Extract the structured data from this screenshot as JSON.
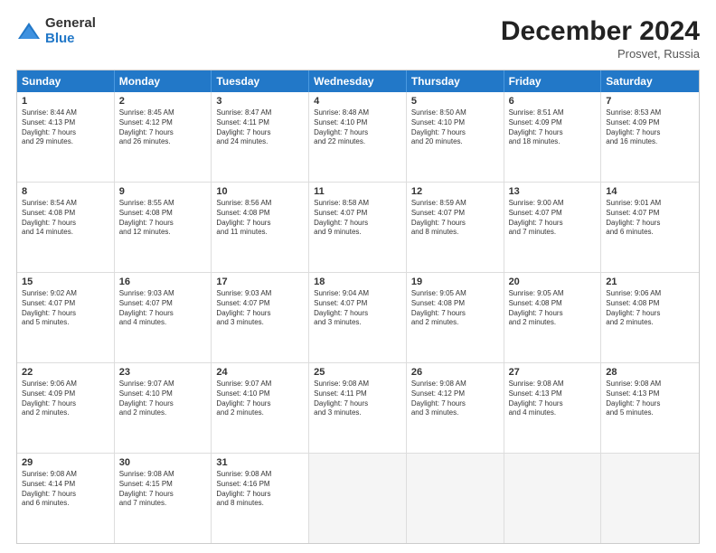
{
  "header": {
    "logo_general": "General",
    "logo_blue": "Blue",
    "title": "December 2024",
    "subtitle": "Prosvet, Russia"
  },
  "days_of_week": [
    "Sunday",
    "Monday",
    "Tuesday",
    "Wednesday",
    "Thursday",
    "Friday",
    "Saturday"
  ],
  "rows": [
    [
      {
        "day": "1",
        "info": "Sunrise: 8:44 AM\nSunset: 4:13 PM\nDaylight: 7 hours\nand 29 minutes."
      },
      {
        "day": "2",
        "info": "Sunrise: 8:45 AM\nSunset: 4:12 PM\nDaylight: 7 hours\nand 26 minutes."
      },
      {
        "day": "3",
        "info": "Sunrise: 8:47 AM\nSunset: 4:11 PM\nDaylight: 7 hours\nand 24 minutes."
      },
      {
        "day": "4",
        "info": "Sunrise: 8:48 AM\nSunset: 4:10 PM\nDaylight: 7 hours\nand 22 minutes."
      },
      {
        "day": "5",
        "info": "Sunrise: 8:50 AM\nSunset: 4:10 PM\nDaylight: 7 hours\nand 20 minutes."
      },
      {
        "day": "6",
        "info": "Sunrise: 8:51 AM\nSunset: 4:09 PM\nDaylight: 7 hours\nand 18 minutes."
      },
      {
        "day": "7",
        "info": "Sunrise: 8:53 AM\nSunset: 4:09 PM\nDaylight: 7 hours\nand 16 minutes."
      }
    ],
    [
      {
        "day": "8",
        "info": "Sunrise: 8:54 AM\nSunset: 4:08 PM\nDaylight: 7 hours\nand 14 minutes."
      },
      {
        "day": "9",
        "info": "Sunrise: 8:55 AM\nSunset: 4:08 PM\nDaylight: 7 hours\nand 12 minutes."
      },
      {
        "day": "10",
        "info": "Sunrise: 8:56 AM\nSunset: 4:08 PM\nDaylight: 7 hours\nand 11 minutes."
      },
      {
        "day": "11",
        "info": "Sunrise: 8:58 AM\nSunset: 4:07 PM\nDaylight: 7 hours\nand 9 minutes."
      },
      {
        "day": "12",
        "info": "Sunrise: 8:59 AM\nSunset: 4:07 PM\nDaylight: 7 hours\nand 8 minutes."
      },
      {
        "day": "13",
        "info": "Sunrise: 9:00 AM\nSunset: 4:07 PM\nDaylight: 7 hours\nand 7 minutes."
      },
      {
        "day": "14",
        "info": "Sunrise: 9:01 AM\nSunset: 4:07 PM\nDaylight: 7 hours\nand 6 minutes."
      }
    ],
    [
      {
        "day": "15",
        "info": "Sunrise: 9:02 AM\nSunset: 4:07 PM\nDaylight: 7 hours\nand 5 minutes."
      },
      {
        "day": "16",
        "info": "Sunrise: 9:03 AM\nSunset: 4:07 PM\nDaylight: 7 hours\nand 4 minutes."
      },
      {
        "day": "17",
        "info": "Sunrise: 9:03 AM\nSunset: 4:07 PM\nDaylight: 7 hours\nand 3 minutes."
      },
      {
        "day": "18",
        "info": "Sunrise: 9:04 AM\nSunset: 4:07 PM\nDaylight: 7 hours\nand 3 minutes."
      },
      {
        "day": "19",
        "info": "Sunrise: 9:05 AM\nSunset: 4:08 PM\nDaylight: 7 hours\nand 2 minutes."
      },
      {
        "day": "20",
        "info": "Sunrise: 9:05 AM\nSunset: 4:08 PM\nDaylight: 7 hours\nand 2 minutes."
      },
      {
        "day": "21",
        "info": "Sunrise: 9:06 AM\nSunset: 4:08 PM\nDaylight: 7 hours\nand 2 minutes."
      }
    ],
    [
      {
        "day": "22",
        "info": "Sunrise: 9:06 AM\nSunset: 4:09 PM\nDaylight: 7 hours\nand 2 minutes."
      },
      {
        "day": "23",
        "info": "Sunrise: 9:07 AM\nSunset: 4:10 PM\nDaylight: 7 hours\nand 2 minutes."
      },
      {
        "day": "24",
        "info": "Sunrise: 9:07 AM\nSunset: 4:10 PM\nDaylight: 7 hours\nand 2 minutes."
      },
      {
        "day": "25",
        "info": "Sunrise: 9:08 AM\nSunset: 4:11 PM\nDaylight: 7 hours\nand 3 minutes."
      },
      {
        "day": "26",
        "info": "Sunrise: 9:08 AM\nSunset: 4:12 PM\nDaylight: 7 hours\nand 3 minutes."
      },
      {
        "day": "27",
        "info": "Sunrise: 9:08 AM\nSunset: 4:13 PM\nDaylight: 7 hours\nand 4 minutes."
      },
      {
        "day": "28",
        "info": "Sunrise: 9:08 AM\nSunset: 4:13 PM\nDaylight: 7 hours\nand 5 minutes."
      }
    ],
    [
      {
        "day": "29",
        "info": "Sunrise: 9:08 AM\nSunset: 4:14 PM\nDaylight: 7 hours\nand 6 minutes."
      },
      {
        "day": "30",
        "info": "Sunrise: 9:08 AM\nSunset: 4:15 PM\nDaylight: 7 hours\nand 7 minutes."
      },
      {
        "day": "31",
        "info": "Sunrise: 9:08 AM\nSunset: 4:16 PM\nDaylight: 7 hours\nand 8 minutes."
      },
      {
        "day": "",
        "info": ""
      },
      {
        "day": "",
        "info": ""
      },
      {
        "day": "",
        "info": ""
      },
      {
        "day": "",
        "info": ""
      }
    ]
  ]
}
